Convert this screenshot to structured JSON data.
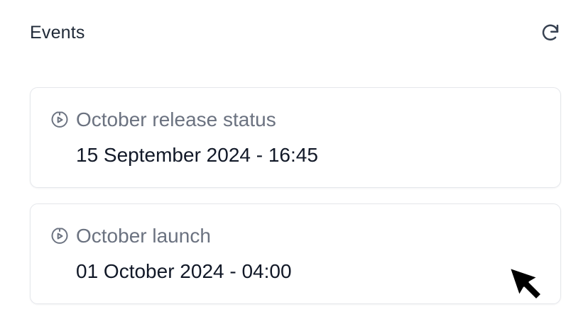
{
  "events_panel": {
    "title": "Events",
    "refresh_icon": "refresh-icon",
    "items": [
      {
        "name": "October release status",
        "date": "15 September 2024 - 16:45",
        "icon": "calendar-clock-icon"
      },
      {
        "name": "October launch",
        "date": "01 October 2024 - 04:00",
        "icon": "calendar-clock-icon"
      }
    ]
  },
  "colors": {
    "title_text": "#1f2937",
    "muted_text": "#6b7280",
    "date_text": "#111827",
    "card_border": "#e5e7eb"
  }
}
